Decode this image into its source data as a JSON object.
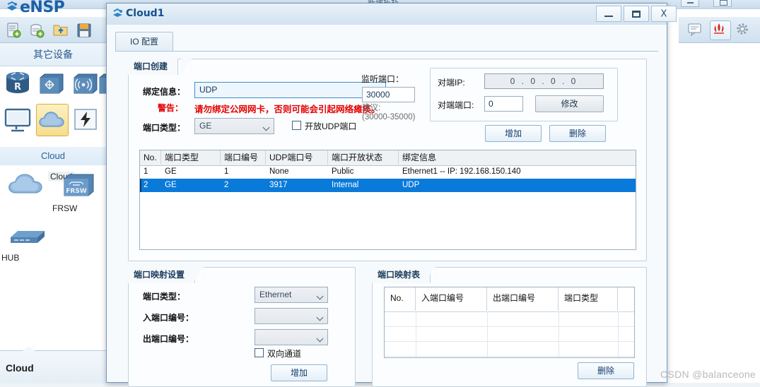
{
  "app": {
    "name": "eNSP",
    "background_tab_label": "新建拓扑",
    "toolbar_buttons": [
      {
        "name": "new-file",
        "label": "新建"
      },
      {
        "name": "new-topology",
        "label": "新建拓扑"
      },
      {
        "name": "open-folder",
        "label": "打开"
      },
      {
        "name": "save",
        "label": "保存"
      }
    ],
    "right_toolbar_buttons": [
      {
        "name": "message",
        "label": "消息"
      },
      {
        "name": "huawei-logo",
        "label": "华为"
      },
      {
        "name": "settings",
        "label": "设置"
      }
    ],
    "status_text": "Cloud"
  },
  "sidebar": {
    "panel_title": "其它设备",
    "category_label": "Cloud",
    "palette_icons": [
      {
        "name": "router",
        "label": "Router"
      },
      {
        "name": "switch",
        "label": "Switch"
      },
      {
        "name": "wlan",
        "label": "WLAN"
      },
      {
        "name": "firewall",
        "label": "FW"
      },
      {
        "name": "pc",
        "label": "PC"
      },
      {
        "name": "cloud",
        "label": "Cloud"
      },
      {
        "name": "power",
        "label": "Power"
      }
    ],
    "devices": [
      {
        "name": "cloud",
        "label": "Cloud"
      },
      {
        "name": "frsw",
        "label": "FRSW"
      },
      {
        "name": "hub",
        "label": "HUB"
      }
    ]
  },
  "dialog": {
    "title": "Cloud1",
    "window_buttons": {
      "minimize": "–",
      "maximize": "□",
      "close": "X"
    },
    "tabs": [
      {
        "label": "IO 配置"
      }
    ],
    "port_create": {
      "group_title": "端口创建",
      "binding_label": "绑定信息：",
      "binding_value": "UDP",
      "warning_label": "警告：",
      "warning_text": "请勿绑定公网网卡，否则可能会引起网络瘫痪。",
      "port_type_label": "端口类型：",
      "port_type_value": "GE",
      "udp_checkbox_label": "开放UDP端口",
      "udp_checkbox_checked": false,
      "listen_port_label": "监听端口：",
      "listen_port_value": "30000",
      "suggestion_label": "建议:",
      "suggestion_range": "(30000-35000)",
      "peer_ip_label": "对端IP:",
      "peer_ip_value": "0 . 0 . 0 . 0",
      "peer_port_label": "对端端口:",
      "peer_port_value": "0",
      "modify_button": "修改",
      "add_button": "增加",
      "delete_button": "删除"
    },
    "port_table": {
      "columns": [
        "No.",
        "端口类型",
        "端口编号",
        "UDP端口号",
        "端口开放状态",
        "绑定信息"
      ],
      "rows": [
        {
          "no": "1",
          "port_type": "GE",
          "port_number": "1",
          "udp_port": "None",
          "state": "Public",
          "binding": "Ethernet1 -- IP: 192.168.150.140",
          "selected": false
        },
        {
          "no": "2",
          "port_type": "GE",
          "port_number": "2",
          "udp_port": "3917",
          "state": "Internal",
          "binding": "UDP",
          "selected": true
        }
      ]
    },
    "mapping_settings": {
      "group_title": "端口映射设置",
      "port_type_label": "端口类型：",
      "port_type_value": "Ethernet",
      "in_port_label": "入端口编号：",
      "in_port_value": "",
      "out_port_label": "出端口编号：",
      "out_port_value": "",
      "bidirectional_label": "双向通道",
      "bidirectional_checked": false,
      "add_button": "增加"
    },
    "mapping_table": {
      "group_title": "端口映射表",
      "columns": [
        "No.",
        "入端口编号",
        "出端口编号",
        "端口类型"
      ],
      "rows": [],
      "delete_button": "删除"
    }
  },
  "watermark": "CSDN @balanceone",
  "colors": {
    "accent": "#1b5fa8",
    "selection": "#0a7ada",
    "warning": "#e60000",
    "dialog_border": "#6f9ac4"
  }
}
